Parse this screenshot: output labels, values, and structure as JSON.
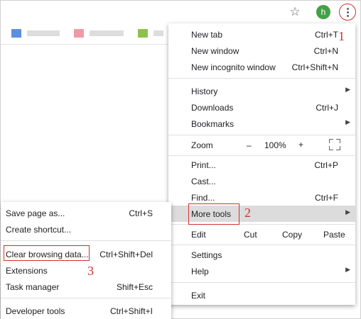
{
  "topbar": {
    "profile_initial": "h",
    "icons": {
      "star": "bookmark-star-icon",
      "menu": "three-dot-menu-icon"
    }
  },
  "bookmarks_bar": {
    "items": [
      {
        "icon_color": "#5b8fe0"
      },
      {
        "icon_color": "#f09aa6"
      },
      {
        "icon_color": "#8bc34a"
      }
    ]
  },
  "main_menu": {
    "new_tab": {
      "label": "New tab",
      "shortcut": "Ctrl+T"
    },
    "new_window": {
      "label": "New window",
      "shortcut": "Ctrl+N"
    },
    "new_incognito_window": {
      "label": "New incognito window",
      "shortcut": "Ctrl+Shift+N"
    },
    "history": {
      "label": "History"
    },
    "downloads": {
      "label": "Downloads",
      "shortcut": "Ctrl+J"
    },
    "bookmarks": {
      "label": "Bookmarks"
    },
    "zoom": {
      "label": "Zoom",
      "minus": "–",
      "value": "100%",
      "plus": "+"
    },
    "print": {
      "label": "Print...",
      "shortcut": "Ctrl+P"
    },
    "cast": {
      "label": "Cast..."
    },
    "find": {
      "label": "Find...",
      "shortcut": "Ctrl+F"
    },
    "more_tools": {
      "label": "More tools"
    },
    "edit": {
      "label": "Edit",
      "cut": "Cut",
      "copy": "Copy",
      "paste": "Paste"
    },
    "settings": {
      "label": "Settings"
    },
    "help": {
      "label": "Help"
    },
    "exit": {
      "label": "Exit"
    }
  },
  "sub_menu": {
    "save_page": {
      "label": "Save page as...",
      "shortcut": "Ctrl+S"
    },
    "create_shortcut": {
      "label": "Create shortcut..."
    },
    "clear_browsing": {
      "label": "Clear browsing data...",
      "shortcut": "Ctrl+Shift+Del"
    },
    "extensions": {
      "label": "Extensions"
    },
    "task_manager": {
      "label": "Task manager",
      "shortcut": "Shift+Esc"
    },
    "developer_tools": {
      "label": "Developer tools",
      "shortcut": "Ctrl+Shift+I"
    }
  },
  "annotations": {
    "step1": "1",
    "step2": "2",
    "step3": "3"
  },
  "colors": {
    "annotation_red": "#d32f2f",
    "profile_green": "#43a047",
    "hover_gray": "#dcdcdc"
  }
}
